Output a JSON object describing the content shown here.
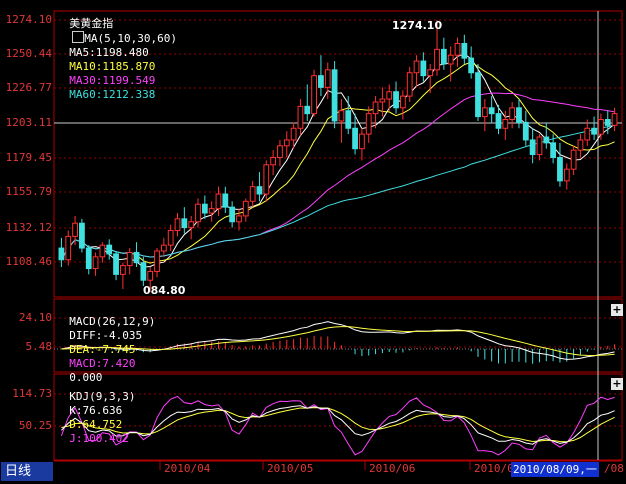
{
  "price_header": {
    "title": "美黄金指",
    "ma_params": "MA(5,10,30,60)",
    "ma5": "MA5:1198.480",
    "ma10": "MA10:1185.870",
    "ma30": "MA30:1199.549",
    "ma60": "MA60:1212.338"
  },
  "macd_header": {
    "params": "MACD(26,12,9)",
    "diff": "DIFF:-4.035",
    "dea": "DEA:-7.745",
    "macd": "MACD:7.420",
    "zero": "0.000"
  },
  "kdj_header": {
    "params": "KDJ(9,3,3)",
    "k": "K:76.636",
    "d": "D:64.752",
    "j": "J:100.402"
  },
  "price_axis": [
    "1274.10",
    "1250.44",
    "1226.77",
    "1203.11",
    "1179.45",
    "1155.79",
    "1132.12",
    "1108.46"
  ],
  "macd_axis": [
    "24.10",
    "5.48"
  ],
  "kdj_axis": [
    "114.73",
    "50.25"
  ],
  "annotations": {
    "high": "1274.10",
    "low": "084.80"
  },
  "bottom": {
    "period_tab": "日线",
    "dates": [
      "2010/04",
      "2010/05",
      "2010/06",
      "2010/0"
    ],
    "cursor_date": "2010/08/09,一",
    "date_tail": "/08"
  },
  "colors": {
    "up": "#ff3030",
    "down": "#40e0e0",
    "ma5": "#ffffff",
    "ma10": "#ffff40",
    "ma30": "#ff40ff",
    "ma60": "#40e0e0",
    "grid": "#9a0000"
  },
  "chart_data": {
    "type": "candlestick",
    "title": "美黄金指",
    "xlabel": "",
    "ylabel": "",
    "ylim": [
      1090,
      1280
    ],
    "x_ticks": [
      "2010/04",
      "2010/05",
      "2010/06",
      "2010/0"
    ],
    "series_names": [
      "MA5",
      "MA10",
      "MA30",
      "MA60"
    ],
    "candles": [
      [
        1118,
        1125,
        1105,
        1110
      ],
      [
        1110,
        1130,
        1106,
        1126
      ],
      [
        1126,
        1140,
        1120,
        1135
      ],
      [
        1135,
        1138,
        1115,
        1118
      ],
      [
        1118,
        1120,
        1100,
        1104
      ],
      [
        1104,
        1115,
        1099,
        1112
      ],
      [
        1112,
        1122,
        1108,
        1120
      ],
      [
        1120,
        1124,
        1110,
        1114
      ],
      [
        1114,
        1116,
        1096,
        1100
      ],
      [
        1100,
        1108,
        1090,
        1106
      ],
      [
        1106,
        1118,
        1100,
        1115
      ],
      [
        1115,
        1122,
        1105,
        1108
      ],
      [
        1108,
        1112,
        1092,
        1096
      ],
      [
        1096,
        1105,
        1088,
        1102
      ],
      [
        1102,
        1118,
        1098,
        1116
      ],
      [
        1116,
        1125,
        1112,
        1120
      ],
      [
        1120,
        1134,
        1116,
        1130
      ],
      [
        1130,
        1142,
        1126,
        1138
      ],
      [
        1138,
        1146,
        1128,
        1132
      ],
      [
        1132,
        1140,
        1124,
        1136
      ],
      [
        1136,
        1152,
        1132,
        1148
      ],
      [
        1148,
        1154,
        1138,
        1142
      ],
      [
        1142,
        1150,
        1136,
        1145
      ],
      [
        1145,
        1160,
        1140,
        1155
      ],
      [
        1155,
        1160,
        1142,
        1146
      ],
      [
        1146,
        1150,
        1132,
        1136
      ],
      [
        1136,
        1145,
        1130,
        1140
      ],
      [
        1140,
        1152,
        1136,
        1150
      ],
      [
        1150,
        1164,
        1146,
        1160
      ],
      [
        1160,
        1170,
        1150,
        1155
      ],
      [
        1155,
        1178,
        1150,
        1175
      ],
      [
        1175,
        1185,
        1168,
        1180
      ],
      [
        1180,
        1192,
        1174,
        1188
      ],
      [
        1188,
        1198,
        1180,
        1192
      ],
      [
        1192,
        1204,
        1186,
        1200
      ],
      [
        1200,
        1220,
        1195,
        1215
      ],
      [
        1215,
        1230,
        1205,
        1210
      ],
      [
        1210,
        1240,
        1208,
        1236
      ],
      [
        1236,
        1250,
        1222,
        1228
      ],
      [
        1228,
        1245,
        1220,
        1240
      ],
      [
        1240,
        1246,
        1200,
        1205
      ],
      [
        1205,
        1220,
        1190,
        1212
      ],
      [
        1212,
        1222,
        1196,
        1200
      ],
      [
        1200,
        1210,
        1182,
        1186
      ],
      [
        1186,
        1200,
        1178,
        1196
      ],
      [
        1196,
        1215,
        1190,
        1210
      ],
      [
        1210,
        1222,
        1200,
        1218
      ],
      [
        1218,
        1228,
        1208,
        1220
      ],
      [
        1220,
        1230,
        1212,
        1225
      ],
      [
        1225,
        1232,
        1210,
        1214
      ],
      [
        1214,
        1226,
        1206,
        1222
      ],
      [
        1222,
        1242,
        1218,
        1238
      ],
      [
        1238,
        1250,
        1228,
        1246
      ],
      [
        1246,
        1252,
        1232,
        1236
      ],
      [
        1236,
        1244,
        1224,
        1240
      ],
      [
        1240,
        1274,
        1236,
        1254
      ],
      [
        1254,
        1262,
        1240,
        1244
      ],
      [
        1244,
        1256,
        1232,
        1250
      ],
      [
        1250,
        1262,
        1242,
        1258
      ],
      [
        1258,
        1264,
        1244,
        1248
      ],
      [
        1248,
        1256,
        1234,
        1238
      ],
      [
        1238,
        1244,
        1205,
        1208
      ],
      [
        1208,
        1220,
        1198,
        1214
      ],
      [
        1214,
        1222,
        1204,
        1210
      ],
      [
        1210,
        1216,
        1196,
        1200
      ],
      [
        1200,
        1212,
        1192,
        1206
      ],
      [
        1206,
        1218,
        1200,
        1214
      ],
      [
        1214,
        1220,
        1200,
        1204
      ],
      [
        1204,
        1212,
        1188,
        1192
      ],
      [
        1192,
        1200,
        1176,
        1182
      ],
      [
        1182,
        1196,
        1178,
        1194
      ],
      [
        1194,
        1204,
        1186,
        1190
      ],
      [
        1190,
        1196,
        1176,
        1180
      ],
      [
        1180,
        1190,
        1160,
        1164
      ],
      [
        1164,
        1176,
        1158,
        1172
      ],
      [
        1172,
        1188,
        1168,
        1185
      ],
      [
        1185,
        1196,
        1180,
        1192
      ],
      [
        1192,
        1206,
        1188,
        1200
      ],
      [
        1200,
        1208,
        1192,
        1196
      ],
      [
        1196,
        1210,
        1192,
        1206
      ],
      [
        1206,
        1212,
        1196,
        1202
      ],
      [
        1202,
        1214,
        1198,
        1210
      ]
    ]
  }
}
